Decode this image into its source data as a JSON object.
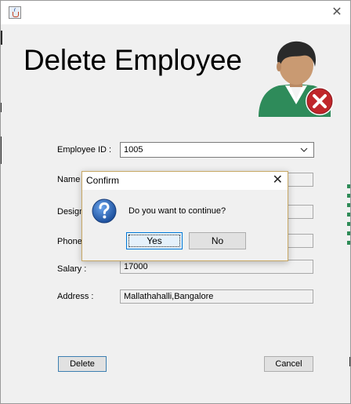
{
  "window": {
    "close_glyph": "✕"
  },
  "header": {
    "title": "Delete Employee",
    "avatar_icon": "employee-delete-icon"
  },
  "form": {
    "employee_id_label": "Employee ID :",
    "employee_id_value": "1005",
    "name_label": "Name",
    "designation_label": "Design",
    "phone_label": "Phone",
    "salary_label": "Salary :",
    "salary_value": "17000",
    "address_label": "Address :",
    "address_value": "Mallathahalli,Bangalore"
  },
  "buttons": {
    "delete_label": "Delete",
    "cancel_label": "Cancel"
  },
  "dialog": {
    "title": "Confirm",
    "close_glyph": "✕",
    "icon": "question-icon",
    "message": "Do you want to continue?",
    "yes_label": "Yes",
    "no_label": "No"
  },
  "colors": {
    "accent": "#0078d7",
    "dialog_border": "#c8a864",
    "window_bg": "#f0f0f0"
  }
}
